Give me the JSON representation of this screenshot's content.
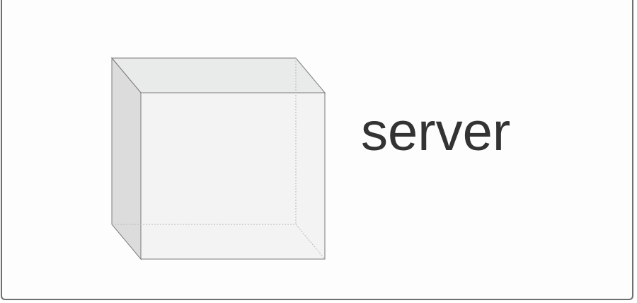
{
  "diagram": {
    "label": "server",
    "icon": "cube-icon",
    "colors": {
      "face_front": "#f2f3f2",
      "face_top": "#e9eaea",
      "face_left": "#dcdcdc",
      "edge": "#7a7a7a",
      "hidden_edge": "#b8b8b8",
      "text": "#333333",
      "frame": "#6f6f6f"
    }
  }
}
